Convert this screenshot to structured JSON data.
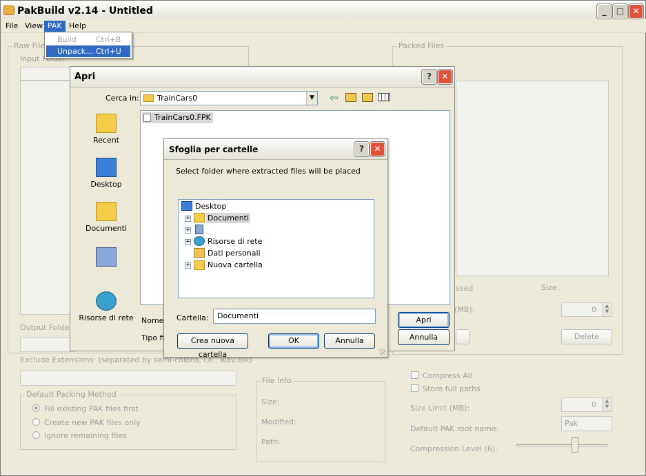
{
  "app": {
    "title": "PakBuild v2.14 - Untitled",
    "menu": [
      "File",
      "View",
      "PAK",
      "Help"
    ],
    "pak_menu": [
      {
        "label": "Build",
        "shortcut": "Ctrl+B",
        "enabled": false
      },
      {
        "label": "Unpack...",
        "shortcut": "Ctrl+U",
        "enabled": true
      }
    ],
    "raw_files_label": "Raw Files",
    "input_folder_label": "Input Folder:",
    "output_folder_label": "Output Folder:",
    "exclude_label": "Exclude Extensions: (separated by semi-colons, i.e., wav;bik)",
    "packing_method": {
      "label": "Default Packing Method",
      "options": [
        "Fill existing PAK files first",
        "Create new PAK files only",
        "Ignore remaining files"
      ],
      "selected": 0
    },
    "file_info": {
      "label": "File Info",
      "size": "Size:",
      "modified": "Modified:",
      "path": "Path:"
    },
    "packed_files_label": "Packed Files",
    "compressed_frag": "ssed",
    "size_label": "Size:",
    "mb_frag": "(MB):",
    "spin_value_1": "0",
    "delete_button": "Delete",
    "compress_all": "Compress All",
    "store_full_paths": "Store full paths",
    "size_limit_label": "Size Limit (MB):",
    "size_limit_value": "0",
    "root_name_label": "Default PAK root name:",
    "root_name_value": "Pak",
    "compression_label": "Compression Level (6):",
    "compression_level": 6
  },
  "open_dialog": {
    "title": "Apri",
    "look_in_label": "Cerca in:",
    "look_in_value": "TrainCars0",
    "places": [
      "Recent",
      "Desktop",
      "Documenti",
      "",
      "Risorse di rete"
    ],
    "file": "TrainCars0.FPK",
    "name_label": "Nome f",
    "type_label": "Tipo file",
    "open_button": "Apri",
    "cancel_button": "Annulla"
  },
  "browse_dialog": {
    "title": "Sfoglia per cartelle",
    "prompt": "Select folder where extracted files will be placed",
    "tree": [
      {
        "label": "Desktop",
        "level": 0,
        "expander": "",
        "icon": "desktop-icon"
      },
      {
        "label": "Documenti",
        "level": 1,
        "expander": "+",
        "icon": "documents-icon",
        "selected": true
      },
      {
        "label": "",
        "level": 1,
        "expander": "+",
        "icon": "computer-icon"
      },
      {
        "label": "Risorse di rete",
        "level": 1,
        "expander": "+",
        "icon": "network-icon"
      },
      {
        "label": "Dati personali",
        "level": 1,
        "expander": "",
        "icon": "user-folder-icon"
      },
      {
        "label": "Nuova cartella",
        "level": 1,
        "expander": "+",
        "icon": "folder-icon"
      }
    ],
    "folder_label": "Cartella:",
    "folder_value": "Documenti",
    "new_folder_button": "Crea nuova cartella",
    "ok_button": "OK",
    "cancel_button": "Annulla"
  }
}
